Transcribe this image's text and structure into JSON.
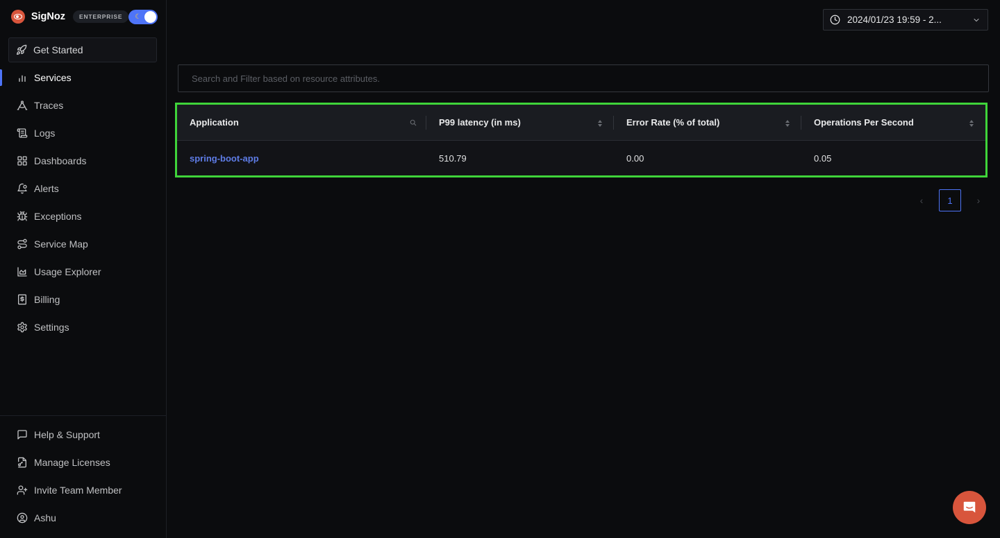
{
  "brand": {
    "name": "SigNoz",
    "badge": "ENTERPRISE",
    "logo_icon": "signoz-eye-logo",
    "theme_toggle_icon": "moon-icon"
  },
  "get_started": {
    "label": "Get Started",
    "icon": "rocket-icon"
  },
  "nav": {
    "items": [
      {
        "label": "Services",
        "icon": "bar-chart-icon",
        "active": true
      },
      {
        "label": "Traces",
        "icon": "draft-compass-icon"
      },
      {
        "label": "Logs",
        "icon": "scroll-icon"
      },
      {
        "label": "Dashboards",
        "icon": "grid-icon"
      },
      {
        "label": "Alerts",
        "icon": "bell-icon"
      },
      {
        "label": "Exceptions",
        "icon": "bug-icon"
      },
      {
        "label": "Service Map",
        "icon": "route-icon"
      },
      {
        "label": "Usage Explorer",
        "icon": "area-chart-icon"
      },
      {
        "label": "Billing",
        "icon": "receipt-icon"
      },
      {
        "label": "Settings",
        "icon": "gear-icon"
      }
    ],
    "bottom": [
      {
        "label": "Help & Support",
        "icon": "message-square-icon"
      },
      {
        "label": "Manage Licenses",
        "icon": "file-key-icon"
      },
      {
        "label": "Invite Team Member",
        "icon": "user-plus-icon"
      },
      {
        "label": "Ashu",
        "icon": "user-circle-icon"
      }
    ]
  },
  "time_picker": {
    "value": "2024/01/23 19:59 - 2...",
    "icon": "clock-icon",
    "chevron": "chevron-down-icon"
  },
  "search": {
    "placeholder": "Search and Filter based on resource attributes.",
    "value": ""
  },
  "table": {
    "columns": [
      {
        "label": "Application",
        "control": "search"
      },
      {
        "label": "P99 latency (in ms)",
        "control": "sort"
      },
      {
        "label": "Error Rate (% of total)",
        "control": "sort"
      },
      {
        "label": "Operations Per Second",
        "control": "sort"
      }
    ],
    "rows": [
      {
        "application": "spring-boot-app",
        "p99": "510.79",
        "error_rate": "0.00",
        "ops": "0.05"
      }
    ],
    "highlight_color": "#3fd43a"
  },
  "pagination": {
    "current": "1",
    "prev": "‹",
    "next": "›"
  },
  "colors": {
    "accent": "#4e74f8",
    "brand": "#d8553c",
    "link": "#5e7ce6"
  },
  "chat_button": {
    "icon": "chat-icon"
  }
}
